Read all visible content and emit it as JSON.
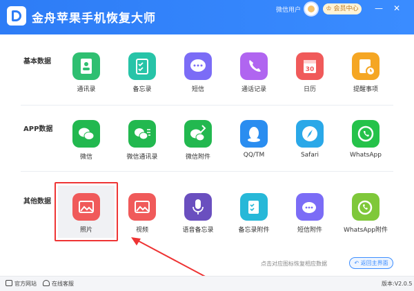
{
  "app": {
    "title": "金舟苹果手机恢复大师"
  },
  "header": {
    "user_name": "微信用户",
    "vip_label": "会员中心",
    "minimize": "—",
    "close": "✕"
  },
  "sections": [
    {
      "label": "基本数据",
      "items": [
        {
          "label": "通讯录",
          "icon": "contacts-icon",
          "color": "#2fbf71"
        },
        {
          "label": "备忘录",
          "icon": "notes-icon",
          "color": "#27c4a8"
        },
        {
          "label": "短信",
          "icon": "message-icon",
          "color": "#7b6cf6"
        },
        {
          "label": "通话记录",
          "icon": "phone-icon",
          "color": "#b065f0"
        },
        {
          "label": "日历",
          "icon": "calendar-icon",
          "color": "#f05a5a"
        },
        {
          "label": "提醒事项",
          "icon": "reminder-icon",
          "color": "#f5a623"
        }
      ]
    },
    {
      "label": "APP数据",
      "items": [
        {
          "label": "微信",
          "icon": "wechat-icon",
          "color": "#22b84f"
        },
        {
          "label": "微信通讯录",
          "icon": "wechat-contacts-icon",
          "color": "#22b84f"
        },
        {
          "label": "微信附件",
          "icon": "wechat-attachment-icon",
          "color": "#22b84f"
        },
        {
          "label": "QQ/TM",
          "icon": "qq-icon",
          "color": "#2a8df0"
        },
        {
          "label": "Safari",
          "icon": "safari-icon",
          "color": "#2aa8e8"
        },
        {
          "label": "WhatsApp",
          "icon": "whatsapp-icon",
          "color": "#25c24a"
        }
      ]
    },
    {
      "label": "其他数据",
      "items": [
        {
          "label": "照片",
          "icon": "photo-icon",
          "color": "#f05a5a"
        },
        {
          "label": "视频",
          "icon": "video-icon",
          "color": "#f05a5a"
        },
        {
          "label": "语音备忘录",
          "icon": "voice-memo-icon",
          "color": "#6a4fbf"
        },
        {
          "label": "备忘录附件",
          "icon": "notes-attachment-icon",
          "color": "#27b8d8"
        },
        {
          "label": "短信附件",
          "icon": "message-attachment-icon",
          "color": "#7b6cf6"
        },
        {
          "label": "WhatsApp附件",
          "icon": "whatsapp-attachment-icon",
          "color": "#7fc83a"
        }
      ]
    }
  ],
  "hint_text": "点击对应图标恢复相应数据",
  "back_button": "返回主界面",
  "footer": {
    "website": "官方网站",
    "support": "在线客服",
    "version": "版本:V2.0.5"
  }
}
